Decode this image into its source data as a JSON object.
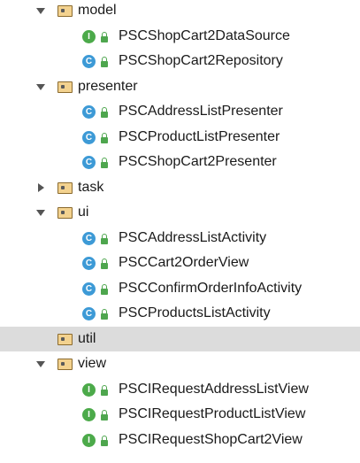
{
  "tree": {
    "packages": [
      {
        "name": "model",
        "expanded": true,
        "selected": false,
        "children": [
          {
            "name": "PSCShopCart2DataSource",
            "kind": "interface",
            "badge": "I",
            "icon": "interface-icon"
          },
          {
            "name": "PSCShopCart2Repository",
            "kind": "class",
            "badge": "C",
            "icon": "class-icon"
          }
        ]
      },
      {
        "name": "presenter",
        "expanded": true,
        "selected": false,
        "children": [
          {
            "name": "PSCAddressListPresenter",
            "kind": "class",
            "badge": "C",
            "icon": "class-icon"
          },
          {
            "name": "PSCProductListPresenter",
            "kind": "class",
            "badge": "C",
            "icon": "class-icon"
          },
          {
            "name": "PSCShopCart2Presenter",
            "kind": "class",
            "badge": "C",
            "icon": "class-icon"
          }
        ]
      },
      {
        "name": "task",
        "expanded": false,
        "selected": false,
        "children": []
      },
      {
        "name": "ui",
        "expanded": true,
        "selected": false,
        "children": [
          {
            "name": "PSCAddressListActivity",
            "kind": "class",
            "badge": "C",
            "icon": "class-icon"
          },
          {
            "name": "PSCCart2OrderView",
            "kind": "class",
            "badge": "C",
            "icon": "class-icon"
          },
          {
            "name": "PSCConfirmOrderInfoActivity",
            "kind": "class",
            "badge": "C",
            "icon": "class-icon"
          },
          {
            "name": "PSCProductsListActivity",
            "kind": "class",
            "badge": "C",
            "icon": "class-icon"
          }
        ]
      },
      {
        "name": "util",
        "expanded": null,
        "selected": true,
        "children": []
      },
      {
        "name": "view",
        "expanded": true,
        "selected": false,
        "children": [
          {
            "name": "PSCIRequestAddressListView",
            "kind": "interface",
            "badge": "I",
            "icon": "interface-icon"
          },
          {
            "name": "PSCIRequestProductListView",
            "kind": "interface",
            "badge": "I",
            "icon": "interface-icon"
          },
          {
            "name": "PSCIRequestShopCart2View",
            "kind": "interface",
            "badge": "I",
            "icon": "interface-icon"
          }
        ]
      }
    ]
  },
  "colors": {
    "selection": "#dcdcdc",
    "interface_badge": "#4caa4a",
    "class_badge": "#3d9ad6",
    "folder_fill": "#f3d28f",
    "lock": "#4ea64e"
  }
}
